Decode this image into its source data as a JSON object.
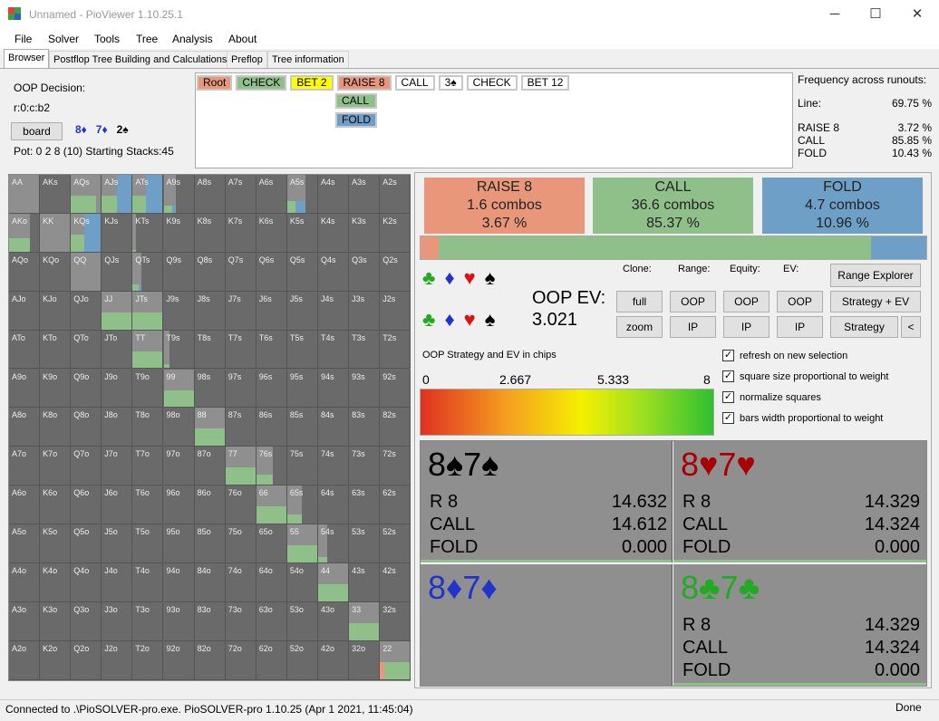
{
  "window": {
    "title": "Unnamed - PioViewer 1.10.25.1",
    "minimize": "─",
    "maximize": "☐",
    "close": "✕"
  },
  "menu": [
    "File",
    "Solver",
    "Tools",
    "Tree",
    "Analysis",
    "About"
  ],
  "tabs": [
    "Browser",
    "Postflop Tree Building and Calculations",
    "Preflop",
    "Tree information"
  ],
  "decision": {
    "label": "OOP Decision:",
    "line": "r:0:c:b2",
    "board_button": "board",
    "board_cards": [
      {
        "t": "8♦",
        "c": "#2233cc"
      },
      {
        "t": "7♦",
        "c": "#2233cc"
      },
      {
        "t": "2♠",
        "c": "#000000"
      }
    ],
    "pot": "Pot: 0 2 8 (10) Starting Stacks:45"
  },
  "line_actions": [
    {
      "t": "Root",
      "bg": "#e8977b"
    },
    {
      "t": "CHECK",
      "bg": "#90c08a"
    },
    {
      "t": "BET 2",
      "bg": "#ffff00"
    },
    {
      "t": "RAISE 8",
      "bg": "#e8977b"
    },
    {
      "t": "CALL",
      "bg": "#ffffff"
    },
    {
      "t": "3♠",
      "bg": "#ffffff"
    },
    {
      "t": "CHECK",
      "bg": "#ffffff"
    },
    {
      "t": "BET 12",
      "bg": "#ffffff"
    }
  ],
  "sub_actions": [
    {
      "t": "CALL",
      "bg": "#90c08a"
    },
    {
      "t": "FOLD",
      "bg": "#6ea0c7"
    }
  ],
  "frequency": {
    "title": "Frequency across runouts:",
    "line_label": "Line:",
    "line_value": "69.75 %",
    "rows": [
      {
        "k": "RAISE 8",
        "v": "3.72 %"
      },
      {
        "k": "CALL",
        "v": "85.85 %"
      },
      {
        "k": "FOLD",
        "v": "10.43 %"
      }
    ]
  },
  "strategy": [
    {
      "name": "RAISE 8",
      "combos": "1.6 combos",
      "pct": "3.67 %",
      "bg": "#e8977b"
    },
    {
      "name": "CALL",
      "combos": "36.6 combos",
      "pct": "85.37 %",
      "bg": "#90c08a"
    },
    {
      "name": "FOLD",
      "combos": "4.7 combos",
      "pct": "10.96 %",
      "bg": "#6ea0c7"
    }
  ],
  "strategy_bar": [
    3.67,
    85.37,
    10.96
  ],
  "colors": {
    "raise": "#e8977b",
    "call": "#90c08a",
    "fold": "#6ea0c7"
  },
  "controls": {
    "clone": "Clone:",
    "range": "Range:",
    "equity": "Equity:",
    "ev": "EV:",
    "full": "full",
    "zoom": "zoom",
    "oop": "OOP",
    "ip": "IP",
    "range_explorer": "Range Explorer",
    "strategy_ev": "Strategy + EV",
    "strategy": "Strategy",
    "back": "<"
  },
  "oop_ev": {
    "label": "OOP EV:",
    "value": "3.021"
  },
  "suits_top": [
    {
      "t": "♣",
      "c": "#22aa22"
    },
    {
      "t": "♦",
      "c": "#2233cc"
    },
    {
      "t": "♥",
      "c": "#dd1111"
    },
    {
      "t": "♠",
      "c": "#000000"
    }
  ],
  "gradient": {
    "label": "OOP Strategy and EV in chips",
    "ticks": [
      "0",
      "2.667",
      "5.333",
      "8"
    ]
  },
  "checkboxes": [
    "refresh on new selection",
    "square size proportional to weight",
    "normalize squares",
    "bars width proportional to weight"
  ],
  "hands": [
    {
      "title": "8♠7♠",
      "color": "#000000",
      "rows": [
        {
          "k": "R 8",
          "v": "14.632"
        },
        {
          "k": "CALL",
          "v": "14.612"
        },
        {
          "k": "FOLD",
          "v": "0.000"
        }
      ],
      "lightbg": true
    },
    {
      "title": "8♥7♥",
      "color": "#aa0000",
      "rows": [
        {
          "k": "R 8",
          "v": "14.329"
        },
        {
          "k": "CALL",
          "v": "14.324"
        },
        {
          "k": "FOLD",
          "v": "0.000"
        }
      ],
      "lightbg": true
    },
    {
      "title": "8♦7♦",
      "color": "#2233cc",
      "rows": [],
      "lightbg": true
    },
    {
      "title": "8♣7♣",
      "color": "#22aa22",
      "rows": [
        {
          "k": "R 8",
          "v": "14.329"
        },
        {
          "k": "CALL",
          "v": "14.324"
        },
        {
          "k": "FOLD",
          "v": "0.000"
        }
      ],
      "lightbg": true
    }
  ],
  "status": {
    "left": "Connected to .\\PioSOLVER-pro.exe. PioSOLVER-pro 1.10.25 (Apr  1 2021, 11:45:04)",
    "right": "Done"
  },
  "grid_labels": [
    [
      "AA",
      "AKs",
      "AQs",
      "AJs",
      "ATs",
      "A9s",
      "A8s",
      "A7s",
      "A6s",
      "A5s",
      "A4s",
      "A3s",
      "A2s"
    ],
    [
      "AKo",
      "KK",
      "KQs",
      "KJs",
      "KTs",
      "K9s",
      "K8s",
      "K7s",
      "K6s",
      "K5s",
      "K4s",
      "K3s",
      "K2s"
    ],
    [
      "AQo",
      "KQo",
      "QQ",
      "QJs",
      "QTs",
      "Q9s",
      "Q8s",
      "Q7s",
      "Q6s",
      "Q5s",
      "Q4s",
      "Q3s",
      "Q2s"
    ],
    [
      "AJo",
      "KJo",
      "QJo",
      "JJ",
      "JTs",
      "J9s",
      "J8s",
      "J7s",
      "J6s",
      "J5s",
      "J4s",
      "J3s",
      "J2s"
    ],
    [
      "ATo",
      "KTo",
      "QTo",
      "JTo",
      "TT",
      "T9s",
      "T8s",
      "T7s",
      "T6s",
      "T5s",
      "T4s",
      "T3s",
      "T2s"
    ],
    [
      "A9o",
      "K9o",
      "Q9o",
      "J9o",
      "T9o",
      "99",
      "98s",
      "97s",
      "96s",
      "95s",
      "94s",
      "93s",
      "92s"
    ],
    [
      "A8o",
      "K8o",
      "Q8o",
      "J8o",
      "T8o",
      "98o",
      "88",
      "87s",
      "86s",
      "85s",
      "84s",
      "83s",
      "82s"
    ],
    [
      "A7o",
      "K7o",
      "Q7o",
      "J7o",
      "T7o",
      "97o",
      "87o",
      "77",
      "76s",
      "75s",
      "74s",
      "73s",
      "72s"
    ],
    [
      "A6o",
      "K6o",
      "Q6o",
      "J6o",
      "T6o",
      "96o",
      "86o",
      "76o",
      "66",
      "65s",
      "64s",
      "63s",
      "62s"
    ],
    [
      "A5o",
      "K5o",
      "Q5o",
      "J5o",
      "T5o",
      "95o",
      "85o",
      "75o",
      "65o",
      "55",
      "54s",
      "53s",
      "52s"
    ],
    [
      "A4o",
      "K4o",
      "Q4o",
      "J4o",
      "T4o",
      "94o",
      "84o",
      "74o",
      "64o",
      "54o",
      "44",
      "43s",
      "42s"
    ],
    [
      "A3o",
      "K3o",
      "Q3o",
      "J3o",
      "T3o",
      "93o",
      "83o",
      "73o",
      "63o",
      "53o",
      "43o",
      "33",
      "32s"
    ],
    [
      "A2o",
      "K2o",
      "Q2o",
      "J2o",
      "T2o",
      "92o",
      "82o",
      "72o",
      "62o",
      "52o",
      "42o",
      "32o",
      "22"
    ]
  ],
  "grid_cells": {
    "AA": {
      "w": 1,
      "bars": []
    },
    "AQs": {
      "w": 1,
      "bars": [
        [
          0,
          0.85,
          1
        ]
      ]
    },
    "AJs": {
      "w": 1,
      "bars": [
        [
          0,
          0.5,
          1
        ],
        [
          0.5,
          0.5,
          2
        ]
      ]
    },
    "ATs": {
      "w": 1,
      "bars": [
        [
          0,
          0.45,
          1
        ],
        [
          0.45,
          0.55,
          2
        ]
      ]
    },
    "A9s": {
      "w": 0.4,
      "bars": [
        [
          0,
          0.7,
          1
        ],
        [
          0.7,
          0.3,
          2
        ]
      ]
    },
    "A5s": {
      "w": 0.6,
      "bars": [
        [
          0,
          0.45,
          1
        ],
        [
          0.45,
          0.55,
          2
        ]
      ]
    },
    "AKo": {
      "w": 0.7,
      "bars": [
        [
          0,
          1,
          1
        ]
      ]
    },
    "KK": {
      "w": 1,
      "bars": []
    },
    "KQs": {
      "w": 1,
      "bars": [
        [
          0,
          0.45,
          1
        ],
        [
          0.45,
          0.55,
          2
        ]
      ]
    },
    "KTs": {
      "w": 0.1,
      "bars": [
        [
          0,
          1,
          1
        ]
      ]
    },
    "QQ": {
      "w": 1,
      "bars": []
    },
    "QTs": {
      "w": 0.3,
      "bars": [
        [
          0,
          0.7,
          1
        ],
        [
          0.7,
          0.3,
          2
        ]
      ]
    },
    "JJ": {
      "w": 1,
      "bars": [
        [
          0,
          1,
          1
        ]
      ]
    },
    "JTs": {
      "w": 1,
      "bars": [
        [
          0,
          1,
          1
        ]
      ]
    },
    "TT": {
      "w": 1,
      "bars": [
        [
          0,
          1,
          1
        ]
      ]
    },
    "T9s": {
      "w": 0.2,
      "bars": [
        [
          0,
          1,
          1
        ]
      ]
    },
    "99": {
      "w": 1,
      "bars": [
        [
          0,
          1,
          1
        ]
      ]
    },
    "88": {
      "w": 1,
      "bars": [
        [
          0,
          1,
          1
        ]
      ]
    },
    "77": {
      "w": 1,
      "bars": [
        [
          0,
          1,
          1
        ]
      ]
    },
    "76s": {
      "w": 0.55,
      "bars": [
        [
          0,
          1,
          1
        ]
      ]
    },
    "66": {
      "w": 1,
      "bars": [
        [
          0,
          1,
          1
        ]
      ]
    },
    "65s": {
      "w": 0.5,
      "bars": [
        [
          0,
          1,
          1
        ]
      ]
    },
    "55": {
      "w": 1,
      "bars": [
        [
          0,
          1,
          1
        ]
      ]
    },
    "54s": {
      "w": 0.3,
      "bars": [
        [
          0,
          1,
          1
        ]
      ]
    },
    "44": {
      "w": 1,
      "bars": [
        [
          0,
          1,
          1
        ]
      ]
    },
    "33": {
      "w": 1,
      "bars": [
        [
          0,
          1,
          1
        ]
      ]
    },
    "22": {
      "w": 1,
      "bars": [
        [
          0,
          0.15,
          0
        ],
        [
          0.15,
          0.85,
          1
        ]
      ]
    }
  }
}
